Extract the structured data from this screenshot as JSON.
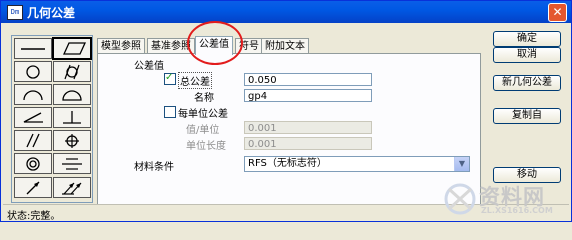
{
  "window": {
    "title": "几何公差",
    "icon_text": "Dm",
    "close_symbol": "✕"
  },
  "tool_icons": [
    "straightness-icon",
    "flatness-icon",
    "circularity-icon",
    "cylindricity-icon",
    "line-profile-icon",
    "surface-profile-icon",
    "angularity-icon",
    "perpendicularity-icon",
    "parallelism-icon",
    "position-icon",
    "concentricity-icon",
    "symmetry-icon",
    "circular-runout-icon",
    "total-runout-icon"
  ],
  "tabs": [
    {
      "label": "模型参照"
    },
    {
      "label": "基准参照"
    },
    {
      "label": "公差值"
    },
    {
      "label": "符号"
    },
    {
      "label": "附加文本"
    }
  ],
  "panel": {
    "group_label": "公差值",
    "total_tolerance": {
      "label": "总公差",
      "checked": true,
      "value": "0.050"
    },
    "name": {
      "label": "名称",
      "value": "gp4"
    },
    "per_unit": {
      "label": "每单位公差",
      "checked": false
    },
    "value_per_unit": {
      "label": "值/单位",
      "value": "0.001"
    },
    "unit_length": {
      "label": "单位长度",
      "value": "0.001"
    },
    "material_condition": {
      "label": "材料条件",
      "value": "RFS（无标志符）"
    }
  },
  "buttons": {
    "ok": "确定",
    "cancel": "取消",
    "new": "新几何公差",
    "copy": "复制自",
    "move": "移动"
  },
  "status": "状态:完整。",
  "watermark": {
    "text": "资料网",
    "url": "ZL.XS1616.COM"
  },
  "colors": {
    "titlebar": "#0058e3",
    "highlight": "#e21c1c",
    "close": "#e4572e"
  }
}
